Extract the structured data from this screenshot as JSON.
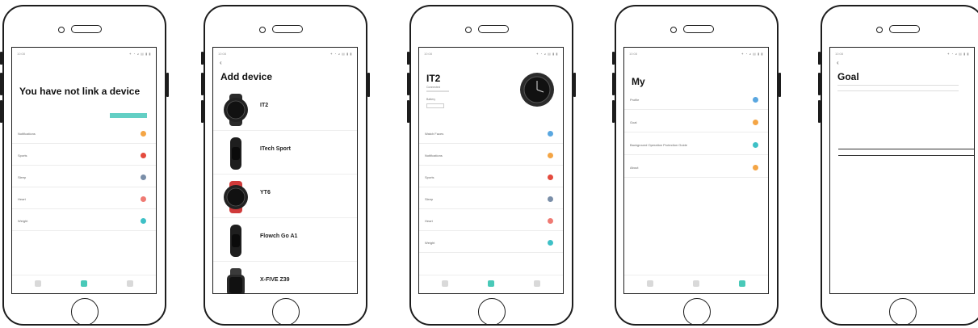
{
  "accent": "#49c9b8",
  "screen1": {
    "status_time": "10:08",
    "status_right": "✦ ◔ ◕ ▤ ▮ ▮",
    "title": "You have not link a device",
    "link_button": "",
    "rows": [
      {
        "label": "Notifications",
        "color": "#f4a545"
      },
      {
        "label": "Sports",
        "color": "#e44a3d"
      },
      {
        "label": "Sleep",
        "color": "#7a8ea8"
      },
      {
        "label": "Heart",
        "color": "#ef7a73"
      },
      {
        "label": "Weight",
        "color": "#3ec0c6"
      }
    ],
    "tabs": [
      {
        "icon": "device-icon"
      },
      {
        "icon": "home-icon"
      },
      {
        "icon": "profile-icon"
      }
    ]
  },
  "screen2": {
    "status_time": "10:08",
    "status_right": "✦ ◔ ◕ ▤ ▮ ▮",
    "back": "‹",
    "title": "Add device",
    "devices": [
      {
        "name": "IT2",
        "sub": "",
        "kind": "round"
      },
      {
        "name": "ITech Sport",
        "sub": "",
        "kind": "band"
      },
      {
        "name": "YT6",
        "sub": "",
        "kind": "round-red"
      },
      {
        "name": "Flowch Go A1",
        "sub": "",
        "kind": "band"
      },
      {
        "name": "X-FIVE Z39",
        "sub": "",
        "kind": "square"
      }
    ]
  },
  "screen3": {
    "status_time": "10:08",
    "status_right": "✦ ◔ ◕ ▤ ▮ ▮",
    "title": "IT2",
    "line1": "Connected",
    "line2": "",
    "line3": "Battery",
    "line4": "",
    "rows": [
      {
        "label": "Watch Faces",
        "color": "#5aa7e0"
      },
      {
        "label": "Notifications",
        "color": "#f4a545"
      },
      {
        "label": "Sports",
        "color": "#e44a3d"
      },
      {
        "label": "Sleep",
        "color": "#7a8ea8"
      },
      {
        "label": "Heart",
        "color": "#ef7a73"
      },
      {
        "label": "Weight",
        "color": "#3ec0c6"
      }
    ]
  },
  "screen4": {
    "status_time": "10:08",
    "status_right": "✦ ◔ ◕ ▤ ▮ ▮",
    "title": "My",
    "rows": [
      {
        "label": "Profile",
        "value": "",
        "color": "#5aa7e0"
      },
      {
        "label": "Goal",
        "value": "",
        "color": "#f4a545"
      },
      {
        "label": "Background Operation Protection Guide",
        "value": "",
        "color": "#3ec0c6"
      },
      {
        "label": "About",
        "value": "",
        "color": "#f4a545"
      }
    ]
  },
  "screen5": {
    "status_time": "10:08",
    "status_right": "✦ ◔ ◕ ▤ ▮ ▮",
    "back": "‹",
    "title": "Goal",
    "description": "",
    "picker": [
      "",
      "",
      "",
      "",
      "",
      "",
      "",
      ""
    ]
  }
}
